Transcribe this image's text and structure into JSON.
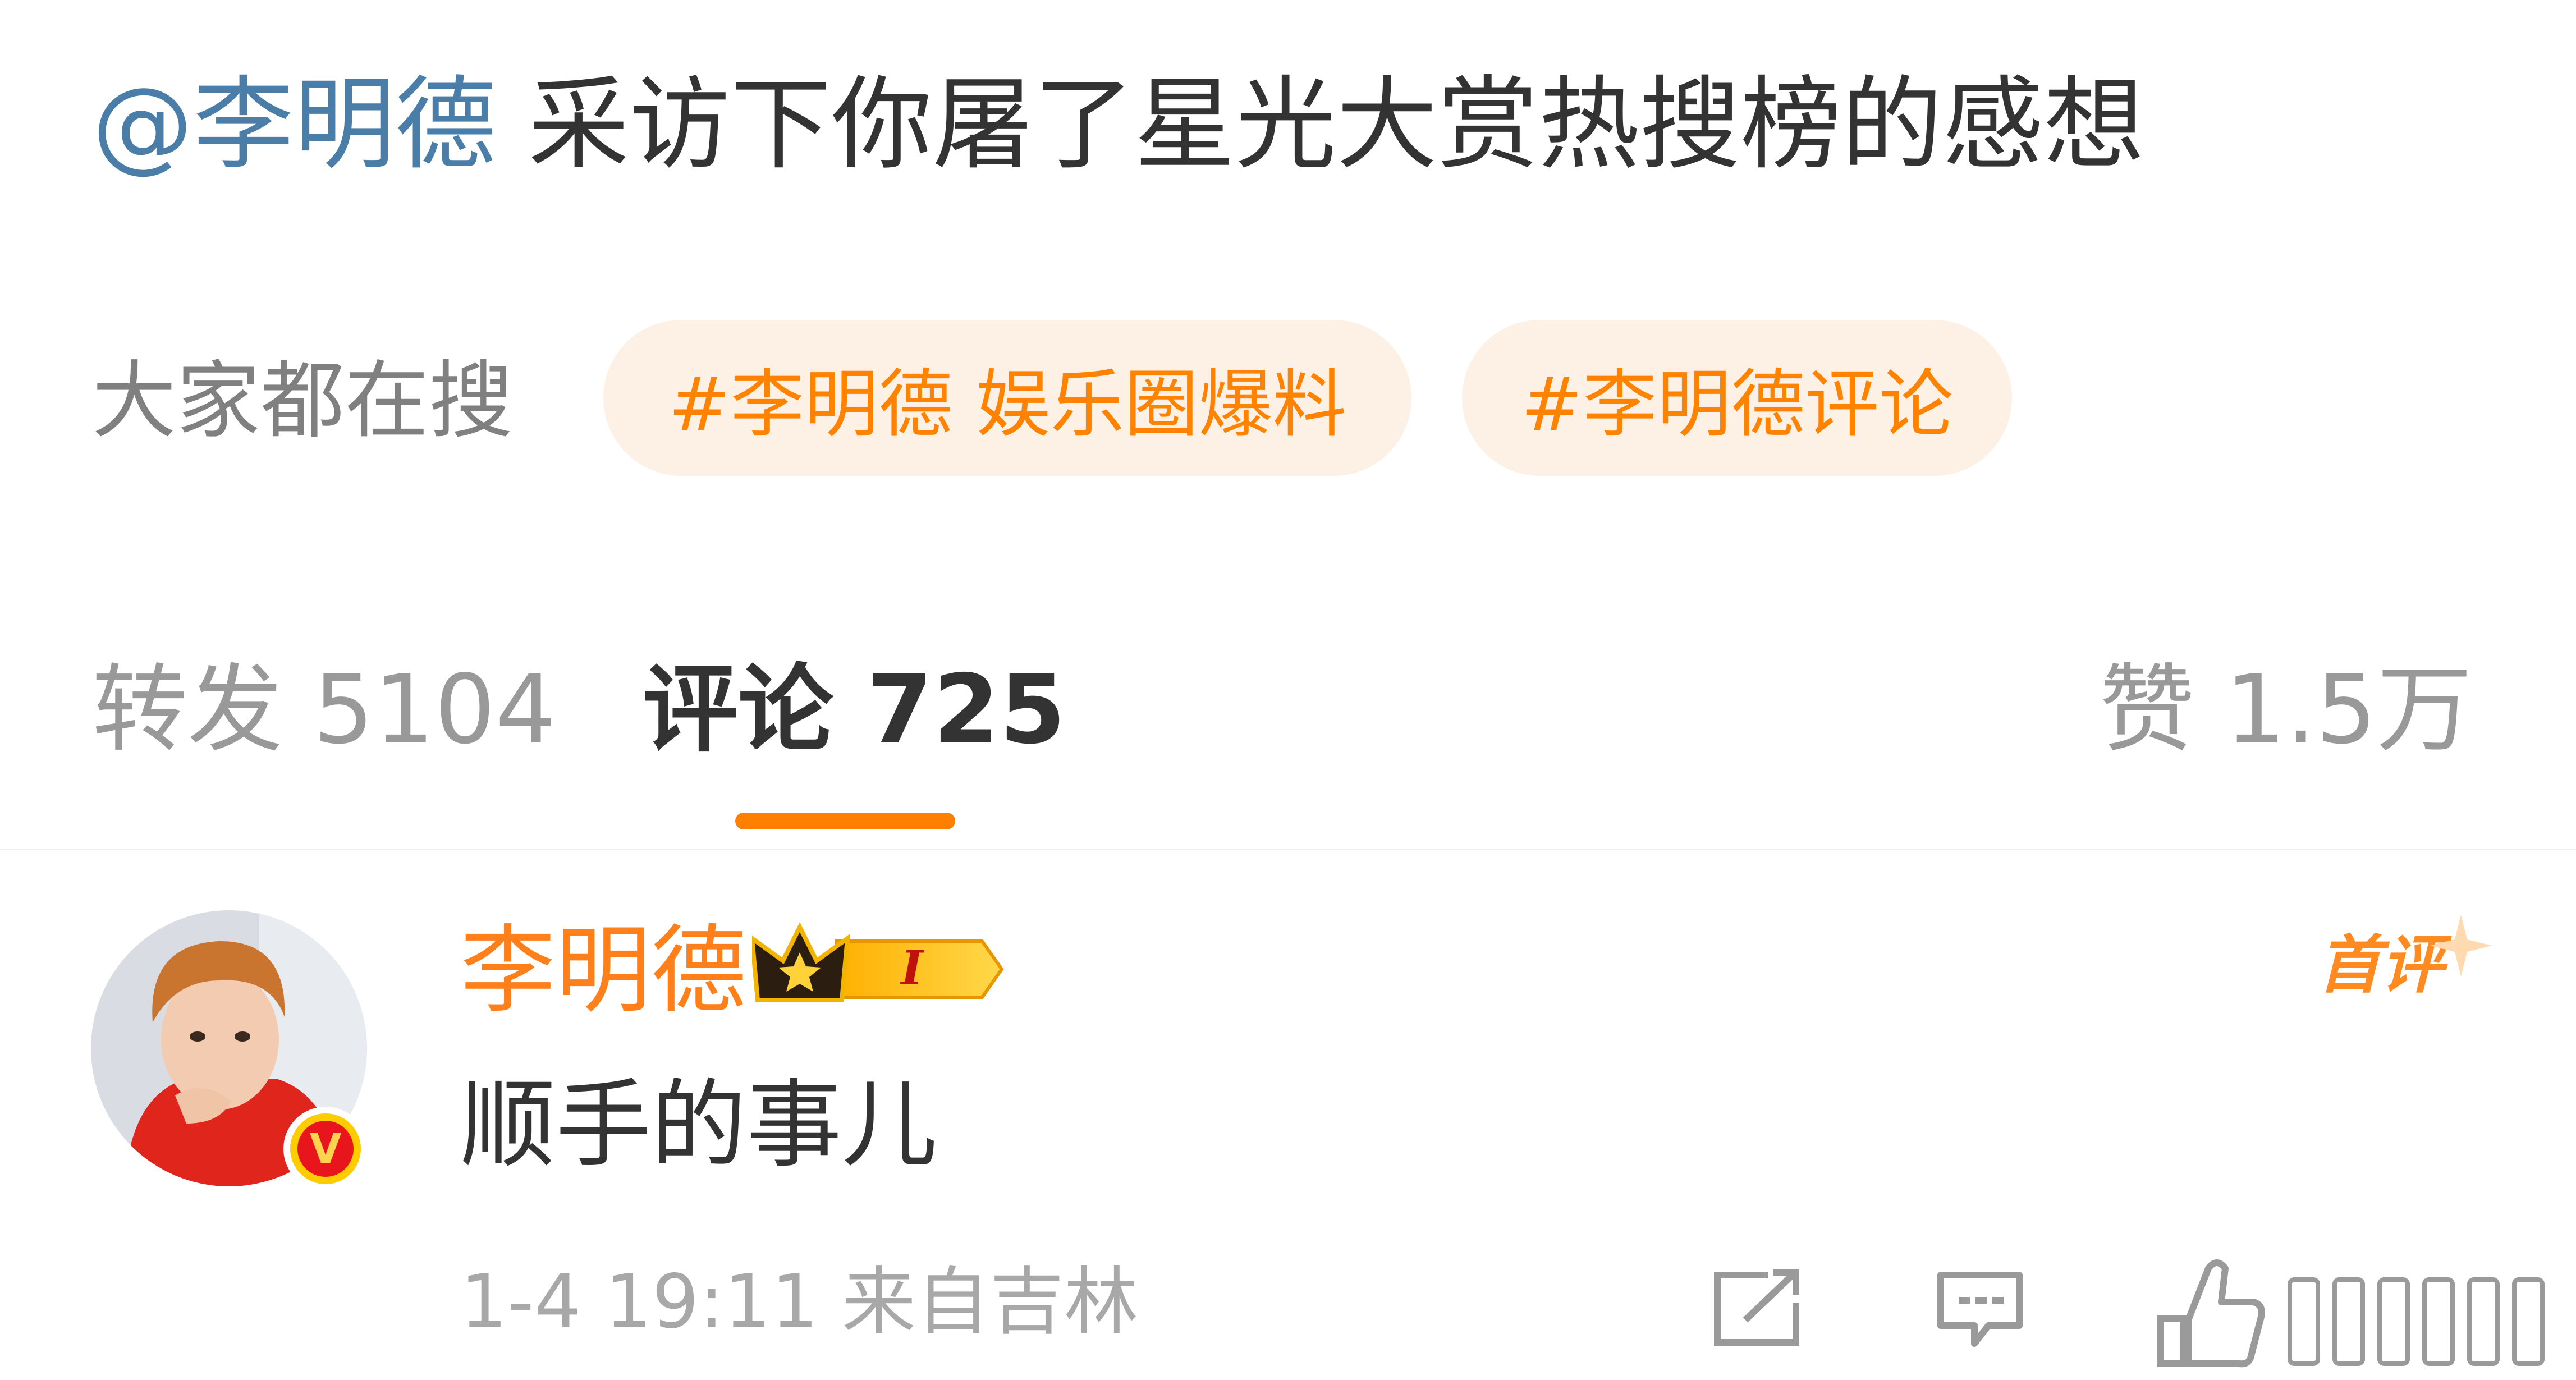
{
  "post": {
    "mention": "@李明德",
    "text": " 采访下你屠了星光大赏热搜榜的感想"
  },
  "search": {
    "label": "大家都在搜",
    "chips": [
      "#李明德 娱乐圈爆料",
      "#李明德评论"
    ]
  },
  "tabs": {
    "repost": "转发 5104",
    "comments": "评论 725",
    "likes": "赞 1.5万"
  },
  "comment": {
    "username": "李明德",
    "badge_level": "I",
    "verified_mark": "V",
    "first_comment_label": "首评",
    "body": "顺手的事儿",
    "meta": "1-4 19:11 来自吉林",
    "icons": [
      "share-icon",
      "reply-icon",
      "like-icon"
    ]
  },
  "colors": {
    "accent": "#ff8200",
    "mention": "#4a7ea8",
    "username": "#ff7f1a",
    "tab_underline": "#ff7f00"
  }
}
